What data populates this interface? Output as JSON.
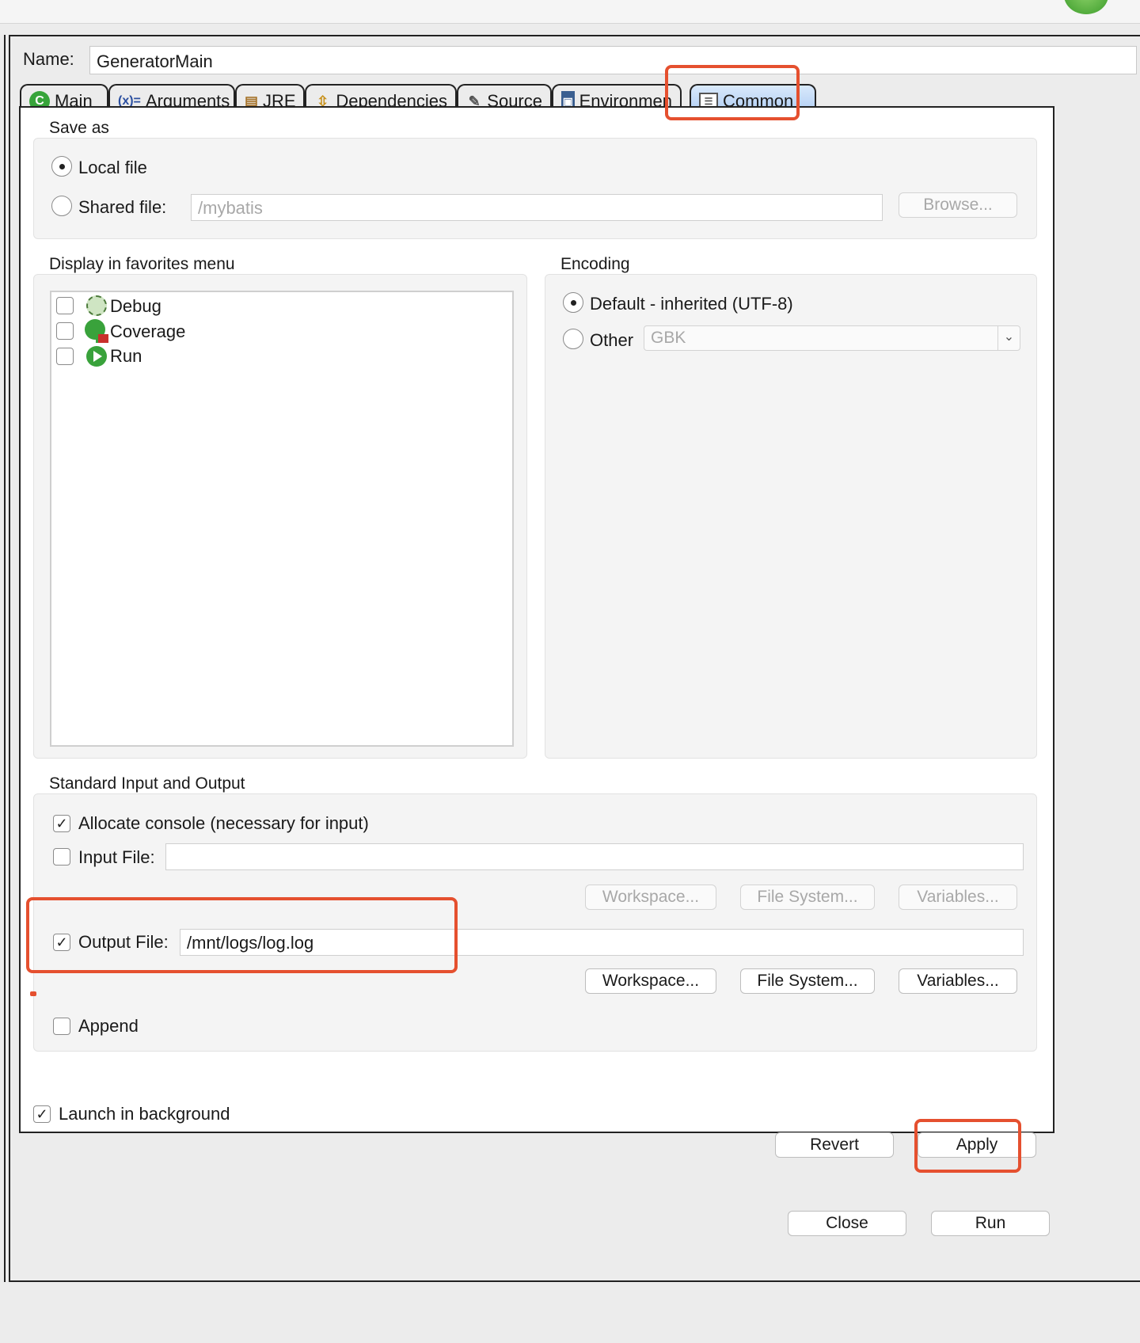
{
  "name_field": {
    "label": "Name:",
    "value": "GeneratorMain"
  },
  "tabs": [
    {
      "label": "Main",
      "icon": "java-class-icon"
    },
    {
      "label": "Arguments",
      "icon": "variables-icon",
      "prefix": "(x)="
    },
    {
      "label": "JRE",
      "icon": "library-icon"
    },
    {
      "label": "Dependencies",
      "icon": "dependencies-icon"
    },
    {
      "label": "Source",
      "icon": "source-lookup-icon"
    },
    {
      "label": "Environmen",
      "icon": "environment-icon"
    },
    {
      "label": "Common",
      "icon": "table-icon",
      "active": true
    }
  ],
  "save_as": {
    "title": "Save as",
    "local_file_label": "Local file",
    "shared_file_label": "Shared file:",
    "shared_file_value": "/mybatis",
    "browse_label": "Browse..."
  },
  "favorites": {
    "title": "Display in favorites menu",
    "items": [
      {
        "label": "Debug",
        "icon": "debug-bug-icon",
        "checked": false
      },
      {
        "label": "Coverage",
        "icon": "coverage-icon",
        "checked": false
      },
      {
        "label": "Run",
        "icon": "run-icon",
        "checked": false
      }
    ]
  },
  "encoding": {
    "title": "Encoding",
    "default_label": "Default - inherited (UTF-8)",
    "other_label": "Other",
    "other_value": "GBK"
  },
  "std_io": {
    "title": "Standard Input and Output",
    "allocate_console_label": "Allocate console (necessary for input)",
    "allocate_console_checked": true,
    "input_file_label": "Input File:",
    "input_file_value": "",
    "input_file_checked": false,
    "output_file_label": "Output File:",
    "output_file_value": "/mnt/logs/log.log",
    "output_file_checked": true,
    "workspace_label": "Workspace...",
    "file_system_label": "File System...",
    "variables_label": "Variables...",
    "append_label": "Append",
    "append_checked": false
  },
  "launch_background": {
    "label": "Launch in background",
    "checked": true
  },
  "footer": {
    "revert_label": "Revert",
    "apply_label": "Apply",
    "close_label": "Close",
    "run_label": "Run"
  },
  "colors": {
    "highlight": "#e5502f",
    "active_tab": "#a9c9f3",
    "run_green": "#39a23b"
  }
}
